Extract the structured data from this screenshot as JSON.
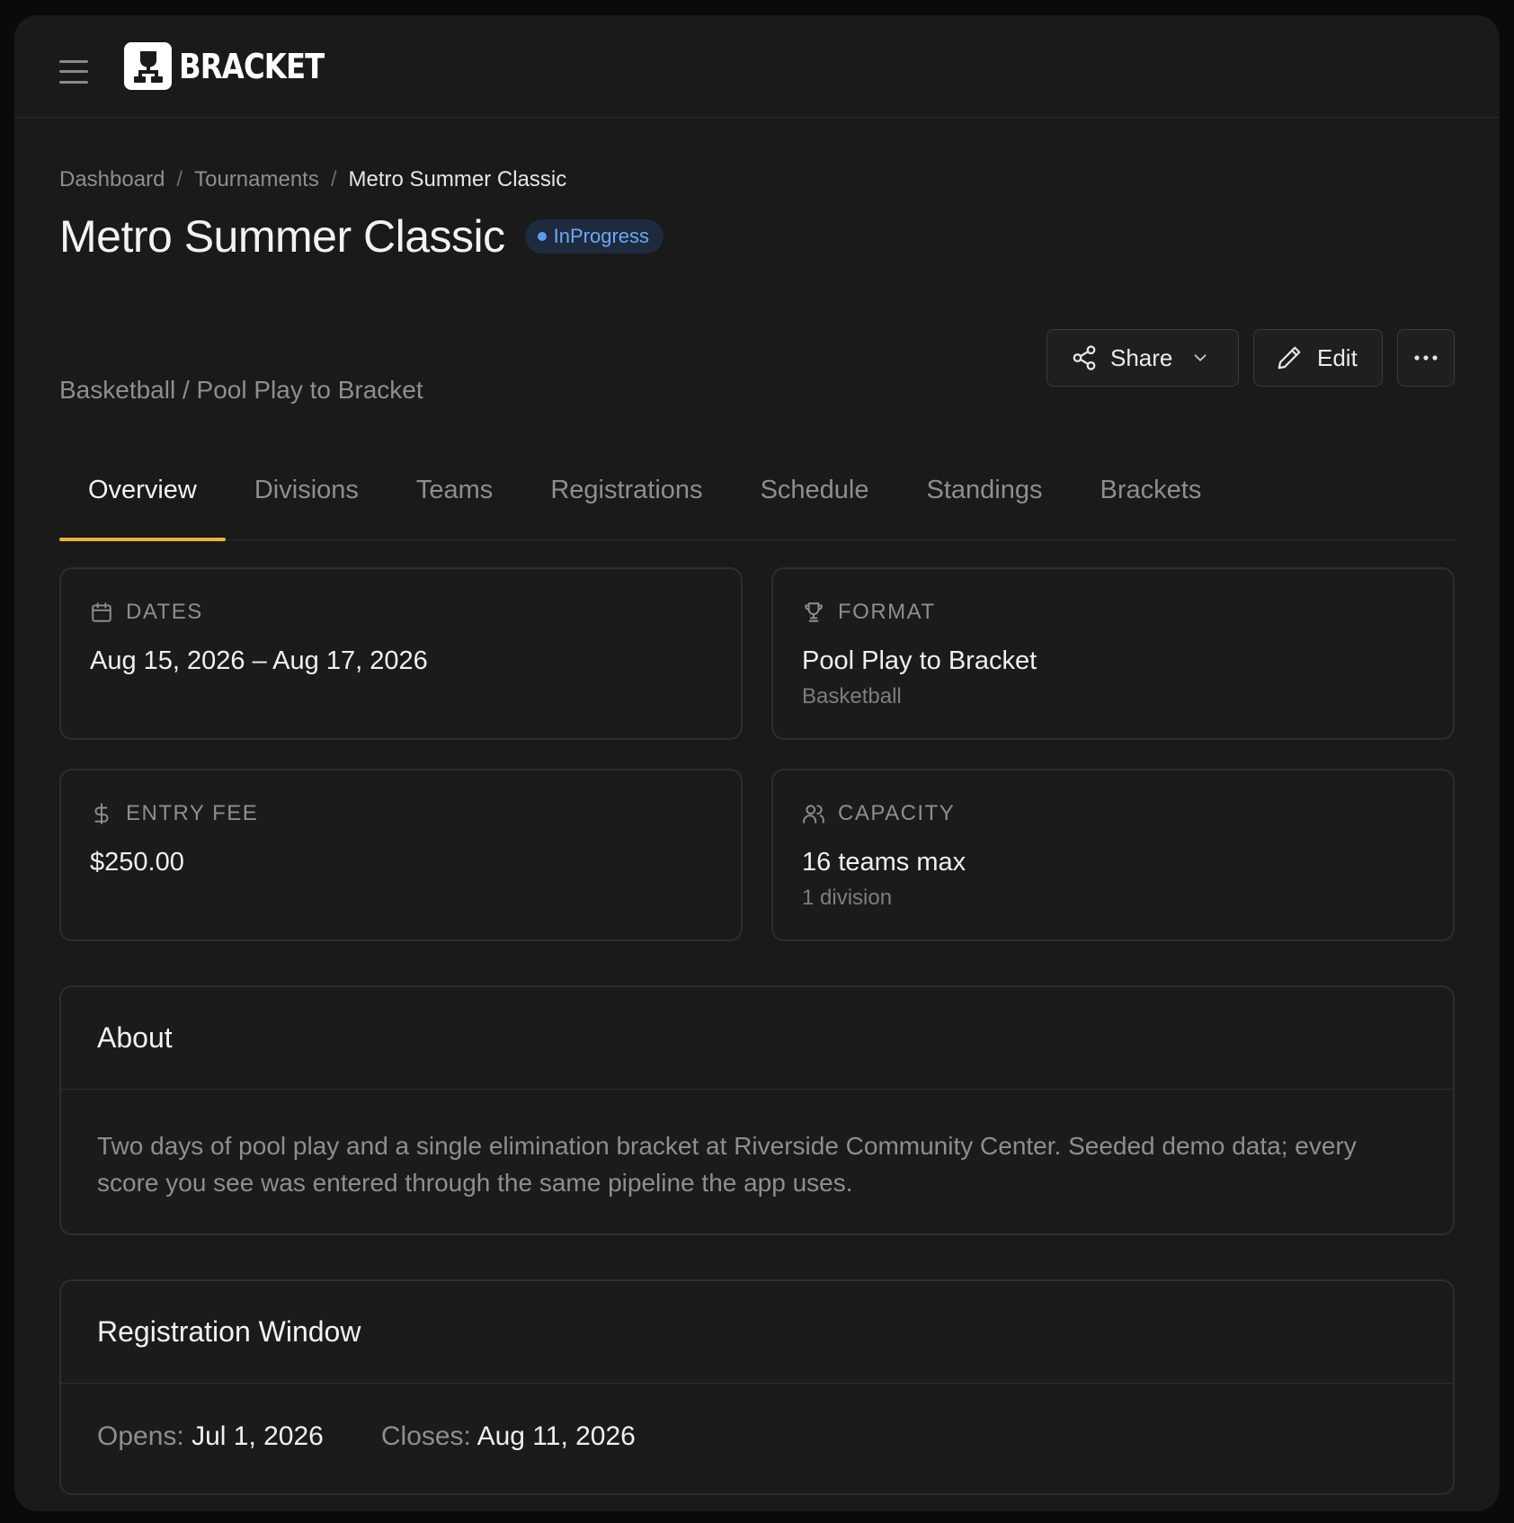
{
  "app": {
    "brand_name": "BRACKET",
    "menu_icon": "hamburger-menu-icon",
    "logo_icon": "bracket-trophy-logo"
  },
  "breadcrumb": {
    "items": [
      "Dashboard",
      "Tournaments",
      "Metro Summer Classic"
    ],
    "separator": "/"
  },
  "header": {
    "title": "Metro Summer Classic",
    "status": "InProgress",
    "subtitle": "Basketball / Pool Play to Bracket"
  },
  "actions": {
    "share_label": "Share",
    "edit_label": "Edit"
  },
  "tabs": [
    {
      "label": "Overview",
      "active": true
    },
    {
      "label": "Divisions",
      "active": false
    },
    {
      "label": "Teams",
      "active": false
    },
    {
      "label": "Registrations",
      "active": false
    },
    {
      "label": "Schedule",
      "active": false
    },
    {
      "label": "Standings",
      "active": false
    },
    {
      "label": "Brackets",
      "active": false
    }
  ],
  "stats": {
    "dates": {
      "label": "DATES",
      "value": "Aug 15, 2026 – Aug 17, 2026",
      "icon": "calendar-icon"
    },
    "format": {
      "label": "FORMAT",
      "value": "Pool Play to Bracket",
      "sub": "Basketball",
      "icon": "trophy-icon"
    },
    "entry_fee": {
      "label": "ENTRY FEE",
      "value": "$250.00",
      "icon": "dollar-icon"
    },
    "capacity": {
      "label": "CAPACITY",
      "value": "16 teams max",
      "sub": "1 division",
      "icon": "users-icon"
    }
  },
  "about": {
    "heading": "About",
    "text": "Two days of pool play and a single elimination bracket at Riverside Community Center. Seeded demo data; every score you see was entered through the same pipeline the app uses."
  },
  "registration": {
    "heading": "Registration Window",
    "opens_label": "Opens:",
    "opens_value": "Jul 1, 2026",
    "closes_label": "Closes:",
    "closes_value": "Aug 11, 2026"
  },
  "colors": {
    "accent_tab": "#e8b23a",
    "status_blue": "#5b9cf2",
    "background": "#1a1a1b"
  }
}
